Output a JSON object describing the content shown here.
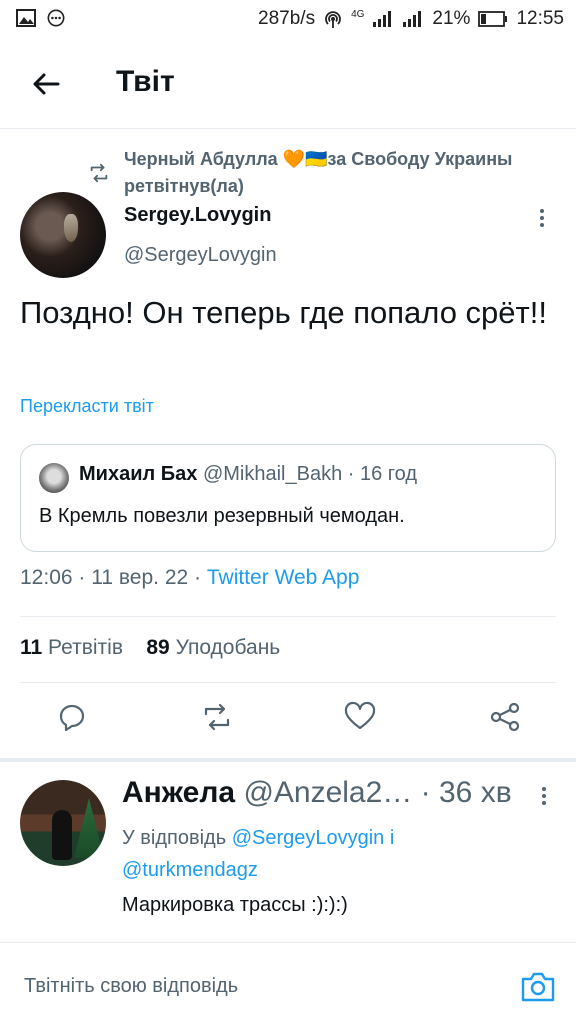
{
  "status_bar": {
    "net_speed": "287b/s",
    "signal_label": "4G",
    "battery": "21%",
    "time": "12:55",
    "icons": [
      "image-icon",
      "more-dots-icon",
      "hotspot-icon",
      "signal-icon",
      "signal-icon",
      "battery-icon"
    ]
  },
  "header": {
    "title": "Твіт",
    "back_icon": "arrow-left-icon"
  },
  "retweet": {
    "by": "Черный Абдулла 🧡🇺🇦за Свободу Украины",
    "action": "ретвітнув(ла)"
  },
  "tweet": {
    "author_name": "Sergey.Lovygin",
    "author_handle": "@SergeyLovygin",
    "text": "Поздно! Он теперь где попало срёт!!",
    "translate": "Перекласти твіт",
    "time": "12:06",
    "date": "11 вер. 22",
    "source": "Twitter Web App",
    "retweets_count": "11",
    "retweets_label": "Ретвітів",
    "likes_count": "89",
    "likes_label": "Уподобань"
  },
  "quote": {
    "name": "Михаил Бах",
    "handle": "@Mikhail_Bakh",
    "age": "16 год",
    "text": "В Кремль повезли резервный чемодан."
  },
  "reply": {
    "name": "Анжела",
    "handle": "@Anzela2…",
    "age": "36 хв",
    "reply_prefix": "У відповідь",
    "mention1": "@SergeyLovygin",
    "joiner": "і",
    "mention2": "@turkmendagz",
    "text": "Маркировка трассы :):):)"
  },
  "composer": {
    "placeholder": "Твітніть свою відповідь"
  },
  "colors": {
    "accent": "#1d9bf0",
    "muted": "#536471",
    "text": "#0f1419",
    "divider": "#e6ecf0"
  }
}
